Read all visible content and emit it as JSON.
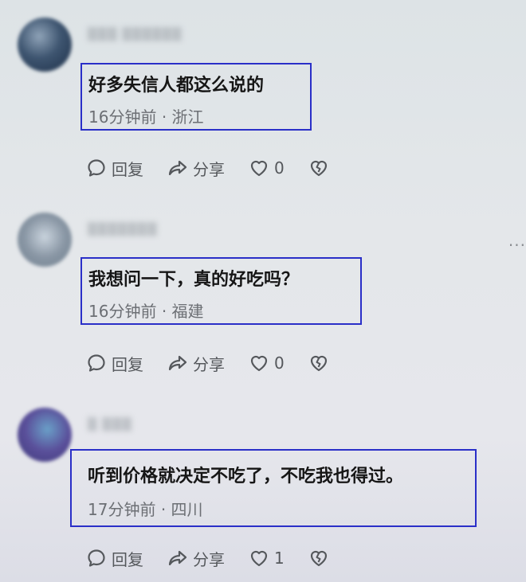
{
  "comments": [
    {
      "username": "▒▒▒ ▒▒▒▒▒▒",
      "text": "好多失信人都这么说的",
      "time": "16分钟前",
      "location": "浙江",
      "reply_label": "回复",
      "share_label": "分享",
      "like_count": "0",
      "avatar_colors": [
        "#1e3049",
        "#8fa3b8"
      ]
    },
    {
      "username": "▒▒▒▒▒▒▒",
      "text": "我想问一下，真的好吃吗？",
      "time": "16分钟前",
      "location": "福建",
      "reply_label": "回复",
      "share_label": "分享",
      "like_count": "0",
      "avatar_colors": [
        "#6f7f8e",
        "#c9d3dd"
      ]
    },
    {
      "username": "▒ ▒▒▒",
      "text": "听到价格就决定不吃了，不吃我也得过。",
      "time": "17分钟前",
      "location": "四川",
      "reply_label": "回复",
      "share_label": "分享",
      "like_count": "1",
      "avatar_colors": [
        "#3d3a7a",
        "#6aa0c8"
      ]
    }
  ],
  "separator": "·",
  "more_label": "···",
  "icons": {
    "reply": "comment-bubble-icon",
    "share": "share-arrow-icon",
    "like": "heart-outline-icon",
    "dislike": "broken-heart-icon"
  },
  "colors": {
    "highlight_border": "#2a2fc8",
    "text": "#161616",
    "meta": "#6c6f74",
    "icon": "#55585c"
  }
}
